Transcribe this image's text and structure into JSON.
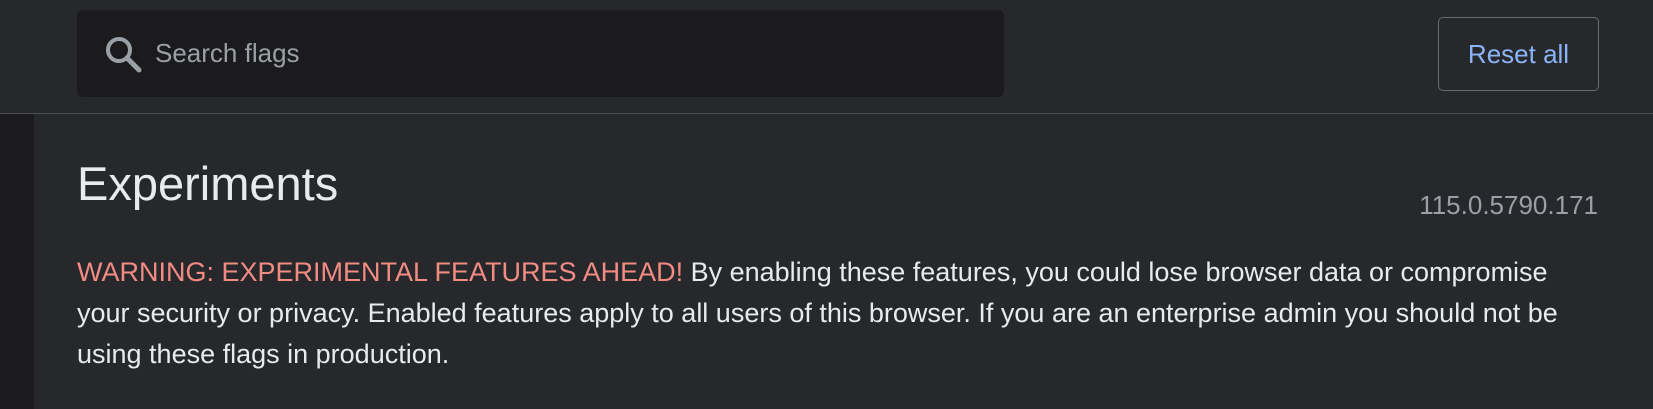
{
  "header": {
    "search": {
      "placeholder": "Search flags",
      "value": "",
      "icon": "search-icon"
    },
    "reset_label": "Reset all"
  },
  "main": {
    "title": "Experiments",
    "version": "115.0.5790.171",
    "warning_label": "WARNING: EXPERIMENTAL FEATURES AHEAD!",
    "warning_body": "By enabling these features, you could lose browser data or compromise your security or privacy. Enabled features apply to all users of this browser. If you are an enterprise admin you should not be using these flags in production."
  },
  "colors": {
    "background": "#27282c",
    "search_background": "#1b1b1d",
    "accent": "#8ab4f8",
    "warning": "#f28b82",
    "text": "#e8eaed",
    "muted_text": "#9aa0a6"
  }
}
